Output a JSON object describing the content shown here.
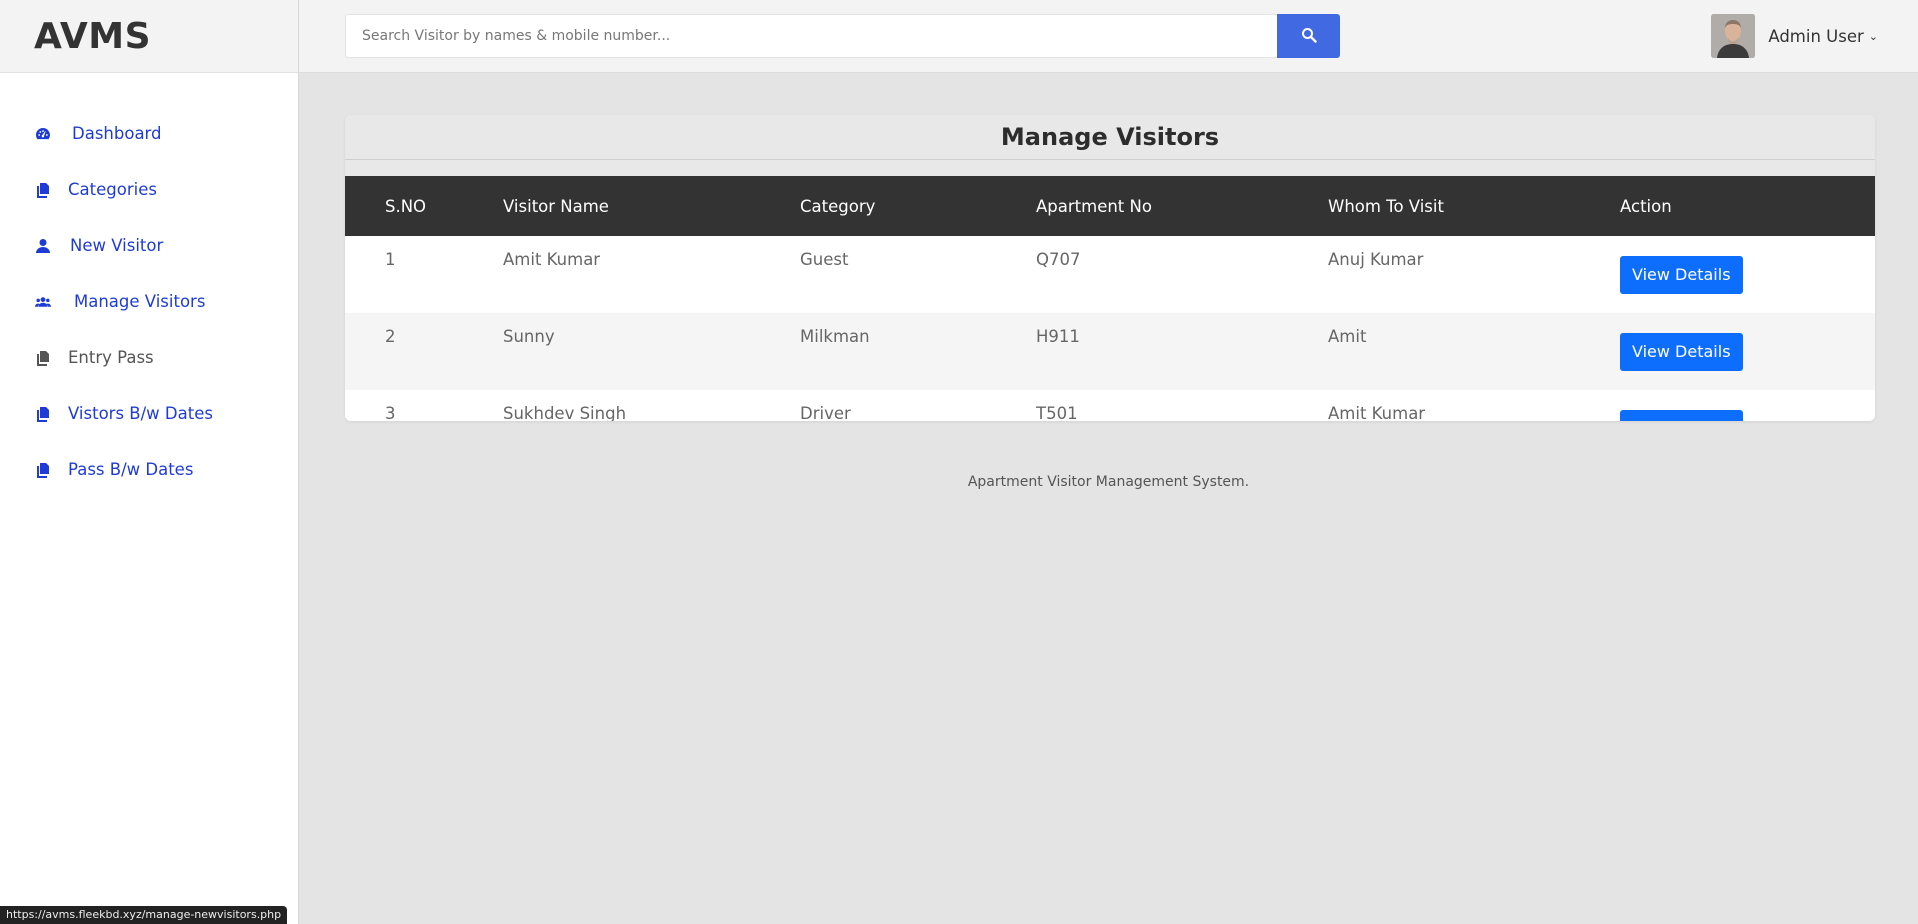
{
  "brand": {
    "name": "AVMS"
  },
  "sidebar": {
    "items": [
      {
        "label": "Dashboard",
        "icon": "tachometer-icon",
        "color": "#1f3bd6"
      },
      {
        "label": "Categories",
        "icon": "copy-icon",
        "color": "#1f3bd6"
      },
      {
        "label": "New Visitor",
        "icon": "user-icon",
        "color": "#1f3bd6"
      },
      {
        "label": "Manage Visitors",
        "icon": "users-icon",
        "color": "#1f3bd6"
      },
      {
        "label": "Entry Pass",
        "icon": "copy-icon",
        "color": "#555555"
      },
      {
        "label": "Vistors B/w Dates",
        "icon": "copy-icon",
        "color": "#1f3bd6"
      },
      {
        "label": "Pass B/w Dates",
        "icon": "copy-icon",
        "color": "#1f3bd6"
      }
    ]
  },
  "search": {
    "placeholder": "Search Visitor by names & mobile number...",
    "value": "",
    "button_icon": "search-icon",
    "button_color": "#4169e1"
  },
  "user": {
    "name": "Admin User"
  },
  "main": {
    "title": "Manage Visitors",
    "table": {
      "headers": [
        "S.NO",
        "Visitor Name",
        "Category",
        "Apartment No",
        "Whom To Visit",
        "Action"
      ],
      "rows": [
        {
          "sno": "1",
          "name": "Amit Kumar",
          "category": "Guest",
          "apartment": "Q707",
          "whom": "Anuj Kumar",
          "action": "View Details"
        },
        {
          "sno": "2",
          "name": "Sunny",
          "category": "Milkman",
          "apartment": "H911",
          "whom": "Amit",
          "action": "View Details"
        },
        {
          "sno": "3",
          "name": "Sukhdev Singh",
          "category": "Driver",
          "apartment": "T501",
          "whom": "Amit Kumar",
          "action": "View Details"
        }
      ]
    }
  },
  "footer": {
    "text": "Apartment Visitor Management System."
  },
  "status_bar": {
    "url": "https://avms.fleekbd.xyz/manage-newvisitors.php"
  }
}
